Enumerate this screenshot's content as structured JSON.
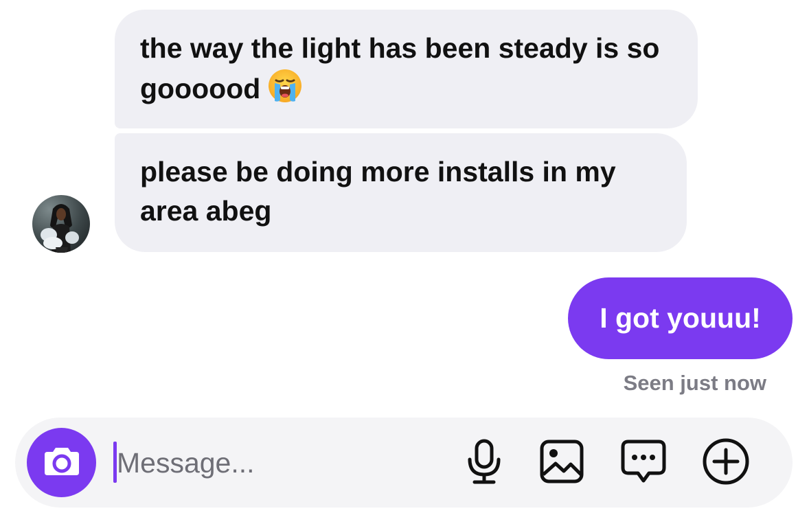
{
  "thread": {
    "incoming": [
      {
        "text": "the way the light has been steady is so goooood",
        "emoji": "loudly-crying-face"
      },
      {
        "text": "please be doing more installs in my area abeg"
      }
    ],
    "outgoing": [
      {
        "text": "I got youuu!"
      }
    ],
    "seen_status": "Seen just now"
  },
  "composer": {
    "placeholder": "Message...",
    "value": ""
  },
  "icons": {
    "camera": "camera-icon",
    "microphone": "microphone-icon",
    "gallery": "image-icon",
    "sticker": "chat-bubble-icon",
    "more": "plus-circle-icon"
  },
  "colors": {
    "accent": "#7b3af0",
    "incoming_bubble": "#efeff4",
    "composer_bg": "#f4f4f6",
    "seen_text": "#7c7c85"
  }
}
